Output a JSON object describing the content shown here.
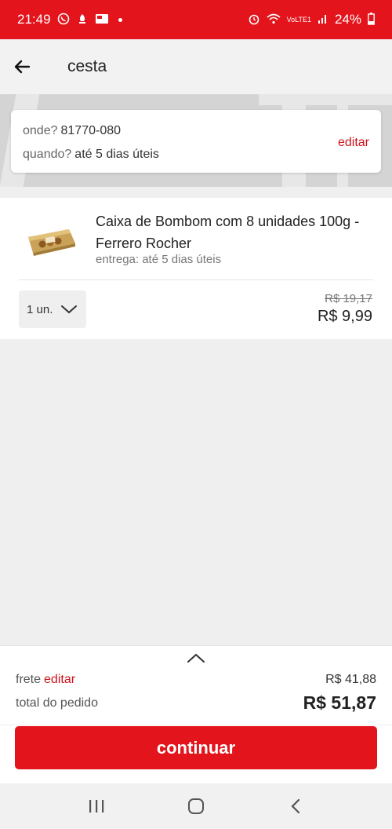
{
  "status_bar": {
    "time": "21:49",
    "battery": "24%",
    "left_icons": [
      "whatsapp-icon",
      "notification-icon",
      "news-icon"
    ],
    "right_icons": [
      "alarm-icon",
      "wifi-icon",
      "volte-signal-icon",
      "battery-icon"
    ],
    "network_label": "VoLTE1"
  },
  "app_bar": {
    "title": "cesta",
    "back_icon": "arrow-left-icon"
  },
  "delivery": {
    "where_label": "onde?",
    "where_value": "81770-080",
    "when_label": "quando?",
    "when_value": "até 5 dias úteis",
    "edit_label": "editar"
  },
  "cart_item": {
    "name": "Caixa de Bombom com 8 unidades 100g - Ferrero Rocher",
    "delivery_note": "entrega: até 5 dias úteis",
    "quantity": "1 un.",
    "old_price": "R$ 19,17",
    "price": "R$ 9,99"
  },
  "summary": {
    "shipping_label": "frete",
    "shipping_edit": "editar",
    "shipping_value": "R$ 41,88",
    "total_label": "total do pedido",
    "total_value": "R$ 51,87",
    "continue_label": "continuar"
  },
  "colors": {
    "brand_red": "#e3141c",
    "link_red": "#d0121b"
  },
  "nav_bar": [
    "recent-apps-icon",
    "home-icon",
    "back-icon"
  ]
}
